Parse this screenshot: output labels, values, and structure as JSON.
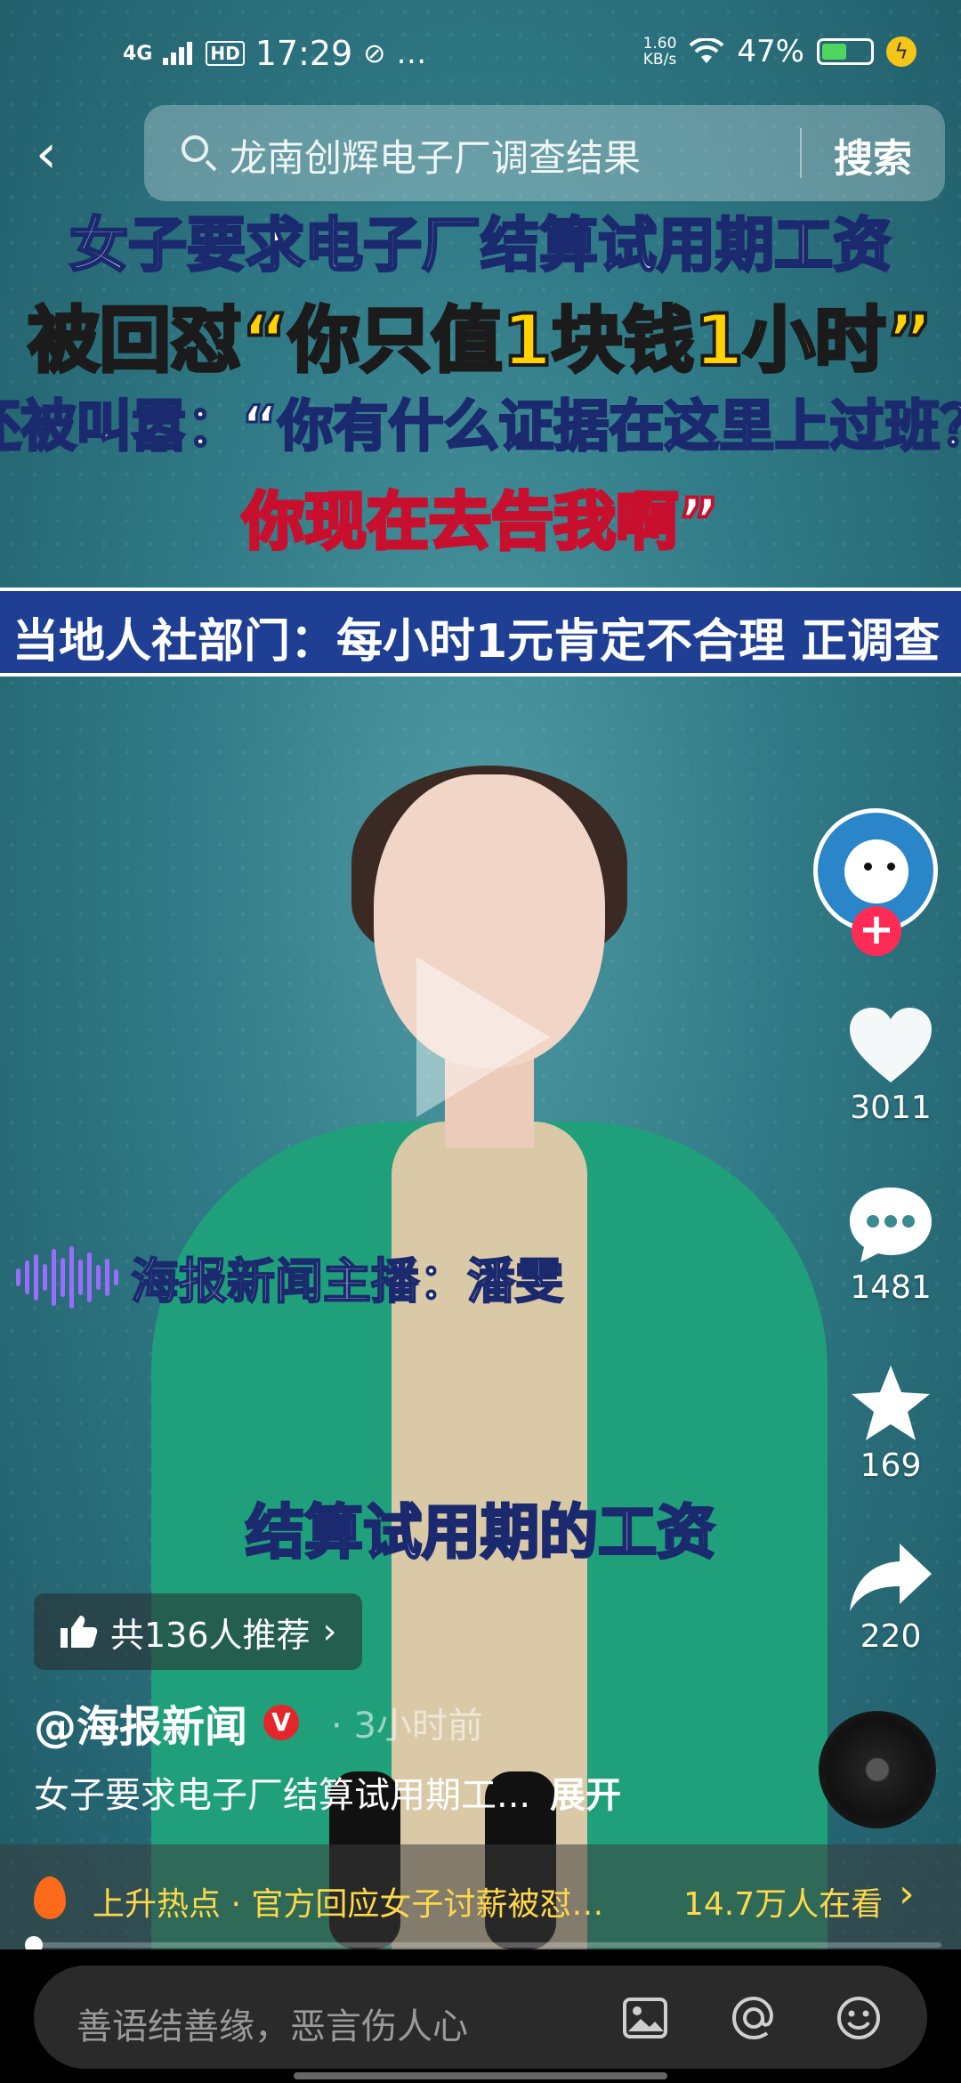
{
  "status_bar": {
    "network": "4G",
    "hd": "HD",
    "time": "17:29",
    "extra": "…",
    "speed_value": "1.60",
    "speed_unit": "KB/s",
    "battery": "47%"
  },
  "search": {
    "query": "龙南创辉电子厂调查结果",
    "button": "搜索"
  },
  "captions": {
    "line1": "女子要求电子厂结算试用期工资",
    "line2": "被回怼“你只值1块钱1小时”",
    "line3": "还被叫嚣：“你有什么证据在这里上过班？",
    "line4": "你现在去告我啊”",
    "banner": "当地人社部门：每小时1元肯定不合理 正调查"
  },
  "anchor_label": "海报新闻主播：潘雯",
  "subtitle": "结算试用期的工资",
  "actions": {
    "likes": "3011",
    "comments": "1481",
    "favorites": "169",
    "shares": "220"
  },
  "recommend": "共136人推荐",
  "author": {
    "name": "@海报新闻",
    "verified": "V",
    "time": "· 3小时前"
  },
  "description": {
    "text": "女子要求电子厂结算试用期工...",
    "more": "展开"
  },
  "hot": {
    "text": "上升热点 · 官方回应女子讨薪被怼…",
    "views": "14.7万人在看"
  },
  "comment_input": {
    "placeholder": "善语结善缘，恶言伤人心"
  },
  "colors": {
    "follow": "#fe2c55",
    "hot_text": "#ffd84a",
    "banner": "#1e3f94",
    "caption_yellow": "#ffd200"
  }
}
